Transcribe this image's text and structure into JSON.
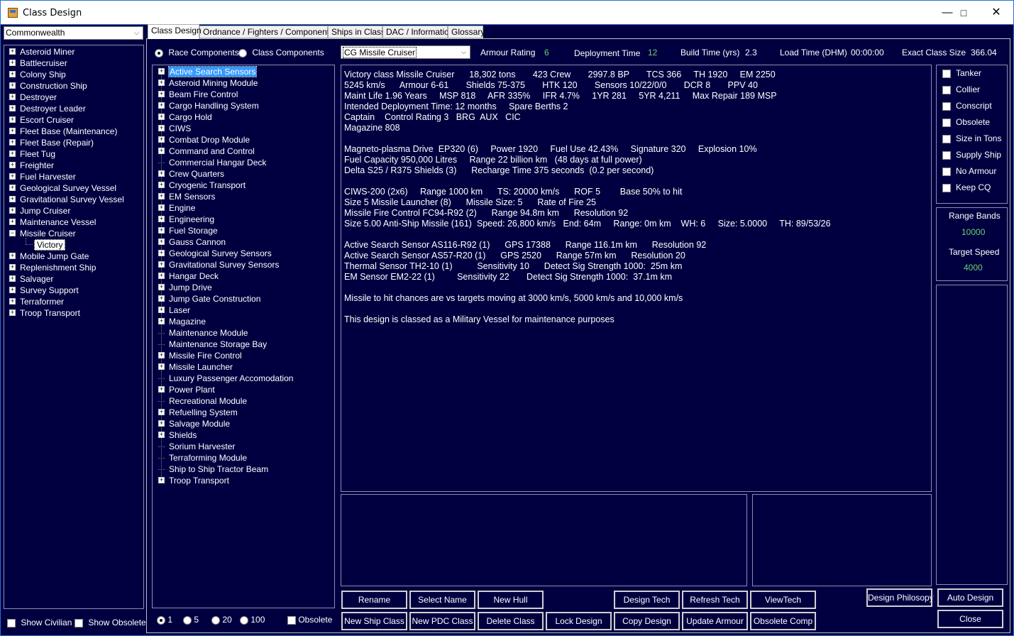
{
  "window": {
    "title": "Class Design"
  },
  "race_select": {
    "value": "Commonwealth"
  },
  "class_tree": [
    {
      "label": "Asteroid Miner",
      "expanded": false
    },
    {
      "label": "Battlecruiser",
      "expanded": false
    },
    {
      "label": "Colony Ship",
      "expanded": false
    },
    {
      "label": "Construction Ship",
      "expanded": false
    },
    {
      "label": "Destroyer",
      "expanded": false
    },
    {
      "label": "Destroyer Leader",
      "expanded": false
    },
    {
      "label": "Escort Cruiser",
      "expanded": false
    },
    {
      "label": "Fleet Base (Maintenance)",
      "expanded": false
    },
    {
      "label": "Fleet Base (Repair)",
      "expanded": false
    },
    {
      "label": "Fleet Tug",
      "expanded": false
    },
    {
      "label": "Freighter",
      "expanded": false
    },
    {
      "label": "Fuel Harvester",
      "expanded": false
    },
    {
      "label": "Geological Survey Vessel",
      "expanded": false
    },
    {
      "label": "Gravitational Survey Vessel",
      "expanded": false
    },
    {
      "label": "Jump Cruiser",
      "expanded": false
    },
    {
      "label": "Maintenance Vessel",
      "expanded": false
    },
    {
      "label": "Missile Cruiser",
      "expanded": true
    },
    {
      "label": "Victory",
      "child": true,
      "selected": true
    },
    {
      "label": "Mobile Jump Gate",
      "expanded": false
    },
    {
      "label": "Replenishment Ship",
      "expanded": false
    },
    {
      "label": "Salvager",
      "expanded": false
    },
    {
      "label": "Survey Support",
      "expanded": false
    },
    {
      "label": "Terraformer",
      "expanded": false
    },
    {
      "label": "Troop Transport",
      "expanded": false
    }
  ],
  "left_footer": {
    "show_civilian": "Show Civilian",
    "show_obsolete": "Show Obsolete"
  },
  "tabs": [
    "Class Design",
    "Ordnance / Fighters / Components",
    "Ships in Class",
    "DAC / Information",
    "Glossary"
  ],
  "component_mode": {
    "race": "Race Components",
    "class": "Class Components",
    "selected": "race"
  },
  "hull_select": {
    "value": "CG Missile Cruiser"
  },
  "stats": {
    "armour_rating_label": "Armour Rating",
    "armour_rating": "6",
    "deployment_time_label": "Deployment Time",
    "deployment_time": "12",
    "build_time_label": "Build Time (yrs)",
    "build_time": "2.3",
    "load_time_label": "Load Time (DHM)",
    "load_time": "00:00:00",
    "class_size_label": "Exact Class Size",
    "class_size": "366.04"
  },
  "component_tree": [
    {
      "label": "Active Search Sensors",
      "expandable": true,
      "selected": true
    },
    {
      "label": "Asteroid Mining Module",
      "expandable": true
    },
    {
      "label": "Beam Fire Control",
      "expandable": true
    },
    {
      "label": "Cargo Handling System",
      "expandable": true
    },
    {
      "label": "Cargo Hold",
      "expandable": true
    },
    {
      "label": "CIWS",
      "expandable": true
    },
    {
      "label": "Combat Drop Module",
      "expandable": true
    },
    {
      "label": "Command and Control",
      "expandable": true
    },
    {
      "label": "Commercial Hangar Deck",
      "expandable": false
    },
    {
      "label": "Crew Quarters",
      "expandable": true
    },
    {
      "label": "Cryogenic Transport",
      "expandable": true
    },
    {
      "label": "EM Sensors",
      "expandable": true
    },
    {
      "label": "Engine",
      "expandable": true
    },
    {
      "label": "Engineering",
      "expandable": true
    },
    {
      "label": "Fuel Storage",
      "expandable": true
    },
    {
      "label": "Gauss Cannon",
      "expandable": true
    },
    {
      "label": "Geological Survey Sensors",
      "expandable": true
    },
    {
      "label": "Gravitational Survey Sensors",
      "expandable": true
    },
    {
      "label": "Hangar Deck",
      "expandable": true
    },
    {
      "label": "Jump Drive",
      "expandable": true
    },
    {
      "label": "Jump Gate Construction",
      "expandable": true
    },
    {
      "label": "Laser",
      "expandable": true
    },
    {
      "label": "Magazine",
      "expandable": true
    },
    {
      "label": "Maintenance Module",
      "expandable": false
    },
    {
      "label": "Maintenance Storage Bay",
      "expandable": false
    },
    {
      "label": "Missile Fire Control",
      "expandable": true
    },
    {
      "label": "Missile Launcher",
      "expandable": true
    },
    {
      "label": "Luxury Passenger Accomodation",
      "expandable": false
    },
    {
      "label": "Power Plant",
      "expandable": true
    },
    {
      "label": "Recreational Module",
      "expandable": false
    },
    {
      "label": "Refuelling System",
      "expandable": true
    },
    {
      "label": "Salvage Module",
      "expandable": true
    },
    {
      "label": "Shields",
      "expandable": true
    },
    {
      "label": "Sorium Harvester",
      "expandable": false
    },
    {
      "label": "Terraforming Module",
      "expandable": false
    },
    {
      "label": "Ship to Ship Tractor Beam",
      "expandable": false
    },
    {
      "label": "Troop Transport",
      "expandable": true
    }
  ],
  "add_quantity": {
    "options": [
      "1",
      "5",
      "20",
      "100"
    ],
    "selected": "1",
    "obsolete": "Obsolete"
  },
  "summary_lines": [
    "Victory class Missile Cruiser      18,302 tons       423 Crew       2997.8 BP       TCS 366     TH 1920     EM 2250",
    "5245 km/s      Armour 6-61       Shields 75-375       HTK 120       Sensors 10/22/0/0       DCR 8       PPV 40",
    "Maint Life 1.96 Years     MSP 818     AFR 335%     IFR 4.7%     1YR 281     5YR 4,211     Max Repair 189 MSP",
    "Intended Deployment Time: 12 months     Spare Berths 2",
    "Captain    Control Rating 3   BRG  AUX   CIC",
    "Magazine 808",
    "",
    "Magneto-plasma Drive  EP320 (6)     Power 1920     Fuel Use 42.43%     Signature 320     Explosion 10%",
    "Fuel Capacity 950,000 Litres     Range 22 billion km   (48 days at full power)",
    "Delta S25 / R375 Shields (3)      Recharge Time 375 seconds  (0.2 per second)",
    "",
    "CIWS-200 (2x6)     Range 1000 km      TS: 20000 km/s      ROF 5        Base 50% to hit",
    "Size 5 Missile Launcher (8)      Missile Size: 5      Rate of Fire 25",
    "Missile Fire Control FC94-R92 (2)      Range 94.8m km      Resolution 92",
    "Size 5.00 Anti-Ship Missile (161)  Speed: 26,800 km/s   End: 64m     Range: 0m km    WH: 6     Size: 5.0000     TH: 89/53/26",
    "",
    "Active Search Sensor AS116-R92 (1)      GPS 17388      Range 116.1m km      Resolution 92",
    "Active Search Sensor AS57-R20 (1)      GPS 2520      Range 57m km      Resolution 20",
    "Thermal Sensor TH2-10 (1)          Sensitivity 10      Detect Sig Strength 1000:  25m km",
    "EM Sensor EM2-22 (1)         Sensitivity 22       Detect Sig Strength 1000:  37.1m km",
    "",
    "Missile to hit chances are vs targets moving at 3000 km/s, 5000 km/s and 10,000 km/s",
    "",
    "This design is classed as a Military Vessel for maintenance purposes"
  ],
  "options": [
    "Tanker",
    "Collier",
    "Conscript",
    "Obsolete",
    "Size in Tons",
    "Supply Ship",
    "No Armour",
    "Keep CQ"
  ],
  "range_bands": {
    "label": "Range Bands",
    "value": "10000",
    "target_speed_label": "Target Speed",
    "target_speed": "4000"
  },
  "buttons": {
    "rename": "Rename",
    "select_name": "Select Name",
    "new_hull": "New Hull",
    "design_tech": "Design Tech",
    "refresh_tech": "Refresh Tech",
    "view_tech": "ViewTech",
    "design_philosophy": "Design Philosopy",
    "auto_design": "Auto Design",
    "new_ship_class": "New Ship Class",
    "new_pdc_class": "New PDC Class",
    "delete_class": "Delete Class",
    "lock_design": "Lock Design",
    "copy_design": "Copy Design",
    "update_armour": "Update Armour",
    "obsolete_comp": "Obsolete Comp",
    "close": "Close"
  }
}
